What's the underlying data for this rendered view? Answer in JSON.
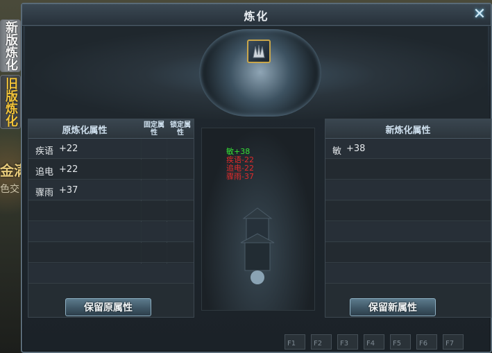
{
  "window": {
    "title": "炼化",
    "close_icon": "close-icon"
  },
  "side_tabs": [
    {
      "label": "新版炼化",
      "active": true
    },
    {
      "label": "旧版炼化",
      "active": false
    }
  ],
  "scene": {
    "text_1": "金满",
    "text_2": "色交"
  },
  "left_panel": {
    "header": "原炼化属性",
    "col_fixed": "固定属性",
    "col_lock": "锁定属性",
    "rows": [
      {
        "name": "疾语",
        "value": "+22"
      },
      {
        "name": "追电",
        "value": "+22"
      },
      {
        "name": "骤雨",
        "value": "+37"
      }
    ],
    "button": "保留原属性"
  },
  "right_panel": {
    "header": "新炼化属性",
    "rows": [
      {
        "name": "敏",
        "value": "+38"
      }
    ],
    "button": "保留新属性"
  },
  "changes": [
    {
      "text": "敏+38",
      "color": "#35e235"
    },
    {
      "text": "疾语-22",
      "color": "#e12b2b"
    },
    {
      "text": "追电-22",
      "color": "#e12b2b"
    },
    {
      "text": "骤雨-37",
      "color": "#e12b2b"
    }
  ],
  "hotkeys": [
    "F1",
    "F2",
    "F3",
    "F4",
    "F5",
    "F6",
    "F7"
  ],
  "item_slot_icon": "claw-icon",
  "accent_colors": {
    "gold": "#c9a64a",
    "increase": "#35e235",
    "decrease": "#e12b2b"
  }
}
